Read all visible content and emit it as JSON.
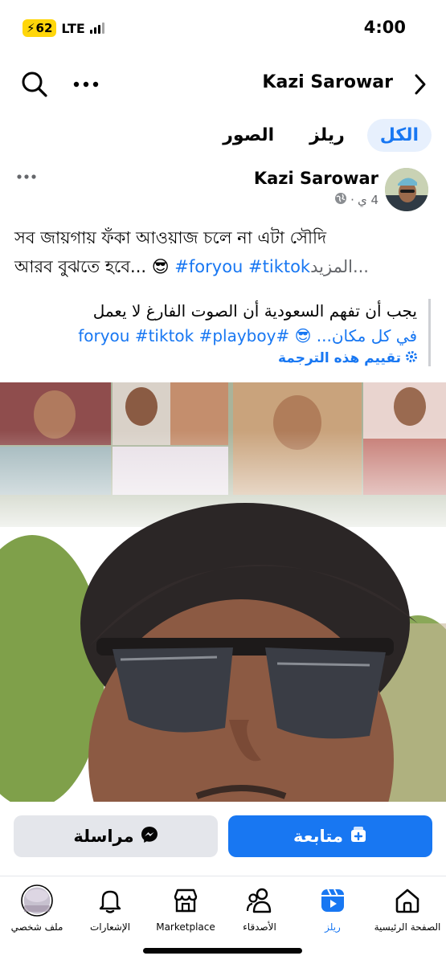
{
  "status_bar": {
    "battery": "62",
    "network": "LTE",
    "time": "4:00"
  },
  "header": {
    "title": "Kazi Sarowar",
    "icons": [
      "search-icon",
      "more-icon",
      "chevron-right-icon"
    ]
  },
  "tabs": [
    {
      "label": "الكل",
      "active": true
    },
    {
      "label": "ريلز",
      "active": false
    },
    {
      "label": "الصور",
      "active": false
    }
  ],
  "post": {
    "author": "Kazi Sarowar",
    "time": "4 ي",
    "privacy_icon": "globe-icon",
    "text_line1": "সব জায়গায় ফঁকা আওয়াজ চলে না  এটা সৌদি",
    "text_line2_start": "আরব বুঝতে হবে... 😎 ",
    "hashtags": "#foryou #tiktok",
    "see_more": "المزيد...",
    "translation_line1": "يجب أن تفهم السعودية أن الصوت الفارغ لا يعمل",
    "translation_line2": "في كل مكان... 😎 #foryou #tiktok #playboy",
    "rate_translation": "تقييم هذه الترجمة"
  },
  "actions": {
    "follow_label": "متابعة",
    "message_label": "مراسلة"
  },
  "bottom_nav": [
    {
      "label": "الصفحة الرئيسية",
      "icon": "home-icon",
      "active": false
    },
    {
      "label": "ريلز",
      "icon": "reels-icon",
      "active": true
    },
    {
      "label": "الأصدقاء",
      "icon": "friends-icon",
      "active": false
    },
    {
      "label": "Marketplace",
      "icon": "marketplace-icon",
      "active": false
    },
    {
      "label": "الإشعارات",
      "icon": "bell-icon",
      "active": false
    },
    {
      "label": "ملف شخصي",
      "icon": "profile-avatar",
      "active": false
    }
  ],
  "colors": {
    "accent": "#1877f2",
    "secondary_text": "#65676b",
    "button_gray": "#e4e6eb"
  }
}
